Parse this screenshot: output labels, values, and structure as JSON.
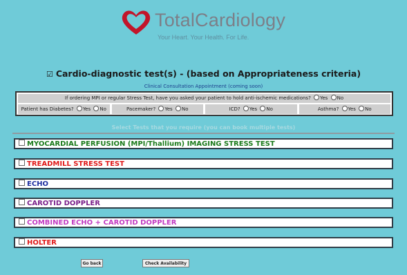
{
  "brand": {
    "name": "TotalCardiology",
    "tagline": "Your Heart. Your Health. For Life.",
    "heart_color": "#c2152a",
    "text_color": "#7c7f88"
  },
  "section": {
    "title": "Cardio-diagnostic test(s) - (based on Appropriateness criteria)",
    "checked": true,
    "consult_note": "Clinical Consultation Appointment (coming soon)"
  },
  "questions": {
    "anti_ischemic": "If ordering MPI or regular Stress Test, have you asked your patient to hold anti-ischemic medications?",
    "yes": "Yes",
    "no": "No",
    "diabetes": "Patient has Diabetes?",
    "pacemaker": "Pacemaker?",
    "icd": "ICD?",
    "asthma": "Asthma?"
  },
  "select_hint": "Select Tests that you require (you can book multiple tests)",
  "tests": [
    {
      "label": "MYOCARDIAL PERFUSION (MPI/Thallium) IMAGING STRESS TEST",
      "color": "#1a7a1a"
    },
    {
      "label": "TREADMILL STRESS TEST",
      "color": "#e01818"
    },
    {
      "label": "ECHO",
      "color": "#1f2fa0"
    },
    {
      "label": "CAROTID DOPPLER",
      "color": "#7a1f8a"
    },
    {
      "label": "COMBINED ECHO + CAROTID DOPPLER",
      "color": "#c23ac2"
    },
    {
      "label": "HOLTER",
      "color": "#e01818"
    }
  ],
  "buttons": {
    "back": "Go back",
    "check": "Check Availability"
  }
}
